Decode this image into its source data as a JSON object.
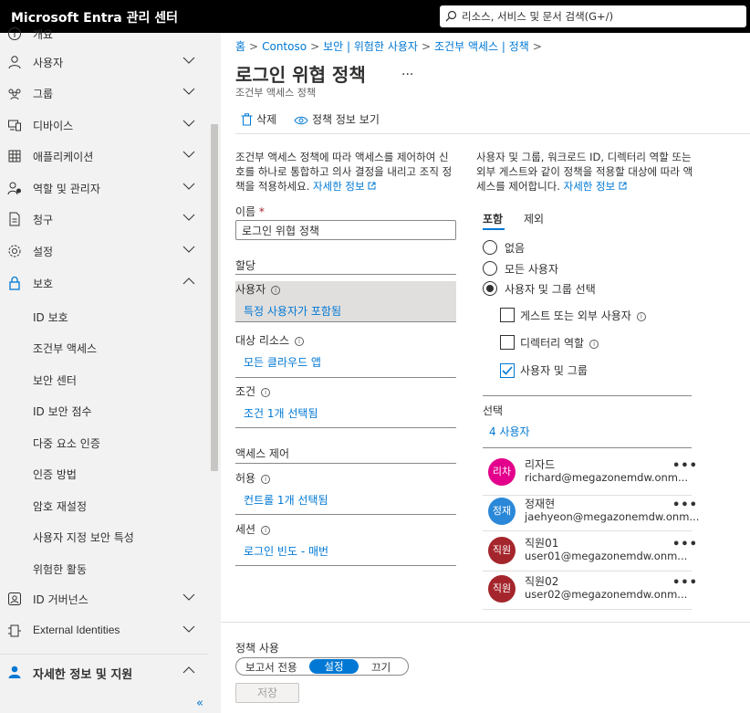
{
  "header": {
    "app_title": "Microsoft Entra 관리 센터",
    "search_placeholder": "리소스, 서비스 및 문서 검색(G+/)"
  },
  "sidebar": {
    "items": [
      {
        "label": "개요",
        "icon": "circle-info-icon"
      },
      {
        "label": "사용자",
        "icon": "person-icon"
      },
      {
        "label": "그룹",
        "icon": "group-icon"
      },
      {
        "label": "디바이스",
        "icon": "devices-icon"
      },
      {
        "label": "애플리케이션",
        "icon": "apps-grid-icon"
      },
      {
        "label": "역할 및 관리자",
        "icon": "role-admin-icon"
      },
      {
        "label": "청구",
        "icon": "billing-doc-icon"
      },
      {
        "label": "설정",
        "icon": "gear-icon"
      },
      {
        "label": "보호",
        "icon": "lock-icon"
      }
    ],
    "protection_subitems": [
      "ID 보호",
      "조건부 액세스",
      "보안 센터",
      "ID 보안 점수",
      "다중 요소 인증",
      "인증 방법",
      "암호 재설정",
      "사용자 지정 보안 특성",
      "위험한 활동"
    ],
    "lower_items": [
      {
        "label": "ID 거버넌스",
        "icon": "governance-icon"
      },
      {
        "label": "External Identities",
        "icon": "external-id-icon"
      }
    ],
    "help_label": "자세한 정보 및 지원",
    "collapse_label": "«"
  },
  "breadcrumb": {
    "items": [
      "홈",
      "Contoso",
      "보안 | 위험한 사용자",
      "조건부 액세스 | 정책"
    ],
    "separator": ">"
  },
  "page": {
    "title": "로그인 위협 정책",
    "more": "...",
    "subtitle": "조건부 액세스 정책"
  },
  "toolbar": {
    "delete_label": "삭제",
    "view_info_label": "정책 정보 보기"
  },
  "left": {
    "description": "조건부 액세스 정책에 따라 액세스를 제어하여 신호를 하나로 통합하고 의사 결정을 내리고 조직 정책을 적용하세요.",
    "learn_more": "자세한 정보",
    "name_label": "이름",
    "required_mark": "*",
    "name_value": "로그인 위협 정책",
    "assignments_header": "할당",
    "users_label": "사용자",
    "users_value": "특정 사용자가 포함됨",
    "target_label": "대상 리소스",
    "target_value": "모든 클라우드 앱",
    "conditions_label": "조건",
    "conditions_value": "조건 1개 선택됨",
    "access_controls_header": "액세스 제어",
    "grant_label": "허용",
    "grant_value": "컨트롤 1개 선택됨",
    "session_label": "세션",
    "session_value": "로그인 빈도 - 매번"
  },
  "right": {
    "description": "사용자 및 그룹, 워크로드 ID, 디렉터리 역할 또는 외부 게스트와 같이 정책을 적용할 대상에 따라 액세스를 제어합니다.",
    "learn_more": "자세한 정보",
    "tabs": [
      "포함",
      "제외"
    ],
    "radios": [
      "없음",
      "모든 사용자",
      "사용자 및 그룹 선택"
    ],
    "checkboxes": [
      {
        "label": "게스트 또는 외부 사용자",
        "checked": false
      },
      {
        "label": "디렉터리 역할",
        "checked": false
      },
      {
        "label": "사용자 및 그룹",
        "checked": true
      }
    ],
    "select_label": "선택",
    "select_count": "4 사용자",
    "users": [
      {
        "avatar": "리차",
        "name": "리자드",
        "email": "richard@megazonemdw.onm...",
        "color": "#e3008c"
      },
      {
        "avatar": "정재",
        "name": "정재현",
        "email": "jaehyeon@megazonemdw.onm...",
        "color": "#2b88d8"
      },
      {
        "avatar": "직원",
        "name": "직원01",
        "email": "user01@megazonemdw.onm...",
        "color": "#a4262c"
      },
      {
        "avatar": "직원",
        "name": "직원02",
        "email": "user02@megazonemdw.onm...",
        "color": "#a4262c"
      }
    ],
    "row_more": "•••"
  },
  "footer": {
    "policy_label": "정책 사용",
    "toggle_options": [
      "보고서 전용",
      "설정",
      "끄기"
    ],
    "toggle_selected": "설정",
    "save_label": "저장"
  },
  "colors": {
    "accent": "#0078d4",
    "topbar": "#000000",
    "sidebar_bg": "#f2f2f2"
  }
}
